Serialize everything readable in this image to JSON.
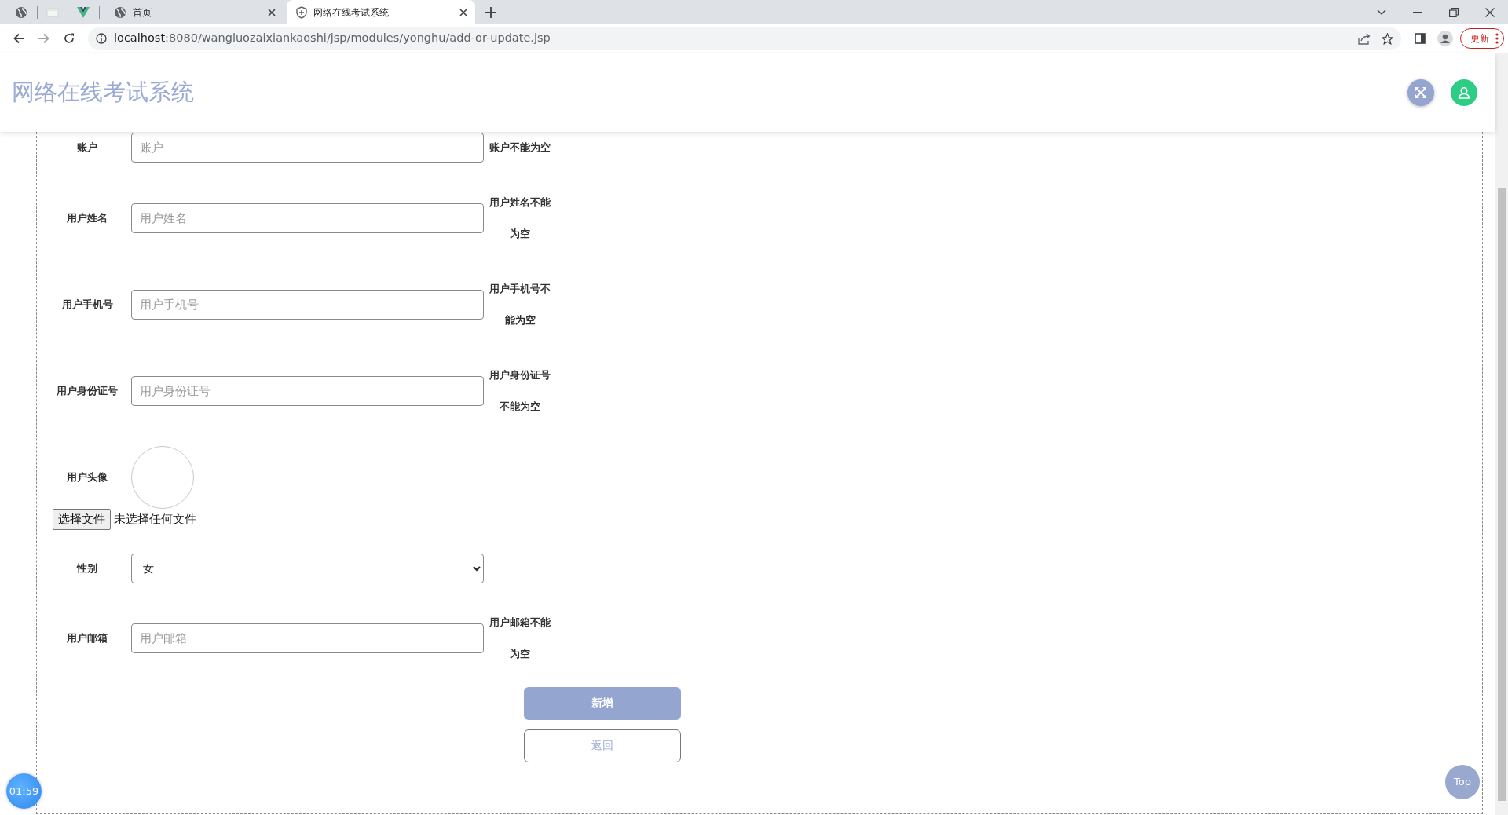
{
  "browser": {
    "tabs": [
      {
        "kind": "pinned",
        "selected": false
      },
      {
        "kind": "pinned",
        "selected": false
      },
      {
        "kind": "pinned",
        "selected": false
      },
      {
        "kind": "page",
        "title": "首页",
        "selected": false
      },
      {
        "kind": "page",
        "title": "网络在线考试系统",
        "selected": true
      }
    ],
    "url": {
      "host": "localhost",
      "rest": ":8080/wangluozaixiankaoshi/jsp/modules/yonghu/add-or-update.jsp"
    },
    "update_button": "更新"
  },
  "app": {
    "title": "网络在线考试系统"
  },
  "form": {
    "fields": [
      {
        "kind": "text",
        "label": "账户",
        "placeholder": "账户",
        "error": "账户不能为空"
      },
      {
        "kind": "text",
        "label": "用户姓名",
        "placeholder": "用户姓名",
        "error": "用户姓名不能为空"
      },
      {
        "kind": "text",
        "label": "用户手机号",
        "placeholder": "用户手机号",
        "error": "用户手机号不能为空"
      },
      {
        "kind": "text",
        "label": "用户身份证号",
        "placeholder": "用户身份证号",
        "error": "用户身份证号不能为空"
      },
      {
        "kind": "image",
        "label": "用户头像",
        "file_button": "选择文件",
        "file_status": "未选择任何文件"
      },
      {
        "kind": "select",
        "label": "性别",
        "value": "女"
      },
      {
        "kind": "text",
        "label": "用户邮箱",
        "placeholder": "用户邮箱",
        "error": "用户邮箱不能为空"
      }
    ],
    "buttons": [
      {
        "kind": "primary",
        "label": "新增"
      },
      {
        "kind": "outline",
        "label": "返回"
      }
    ]
  },
  "timer": "01:59",
  "top_button": "Top"
}
